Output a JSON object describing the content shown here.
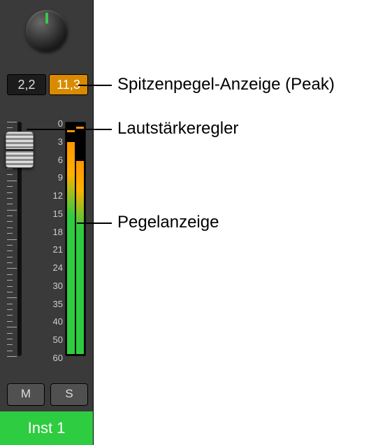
{
  "channel": {
    "pan_value": 0,
    "peak_left": "2,2",
    "peak_right": "11,3",
    "peak_right_clipping": true,
    "db_scale": [
      "0",
      "3",
      "6",
      "9",
      "12",
      "15",
      "18",
      "21",
      "24",
      "30",
      "35",
      "40",
      "50",
      "60"
    ],
    "fader_position_pct": 12,
    "meter": {
      "left_fill_pct": 92,
      "right_fill_pct": 84,
      "left_peak_hold_pct": 96.5,
      "right_peak_hold_pct": 97.5
    },
    "mute_label": "M",
    "solo_label": "S",
    "name": "Inst 1"
  },
  "callouts": {
    "peak": "Spitzenpegel-Anzeige (Peak)",
    "fader": "Lautstärkeregler",
    "meter": "Pegelanzeige"
  }
}
